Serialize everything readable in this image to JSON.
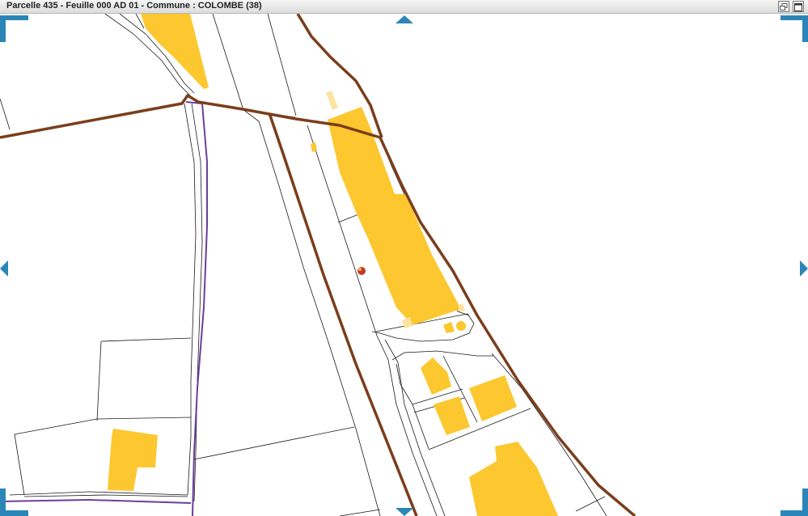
{
  "window": {
    "title": "Parcelle 435 - Feuille 000 AD 01 - Commune : COLOMBE (38)",
    "restore_icon": "restore-window-icon",
    "maximize_icon": "maximize-window-icon"
  },
  "map": {
    "colors": {
      "background": "#ffffff",
      "parcel_line": "#1a1a1a",
      "building": "#fcc72f",
      "building_light": "#fde3a0",
      "commune_boundary": "#7a3e1c",
      "section_boundary": "#6a3f9a",
      "marker": "#c0392b",
      "pan_control": "#2b86b7"
    },
    "selected_parcel_marker": "location-marker-icon",
    "pan_controls": [
      "pan-up-icon",
      "pan-down-icon",
      "pan-left-icon",
      "pan-right-icon"
    ],
    "corner_brackets": [
      "top-left",
      "top-right",
      "bottom-left",
      "bottom-right"
    ]
  }
}
